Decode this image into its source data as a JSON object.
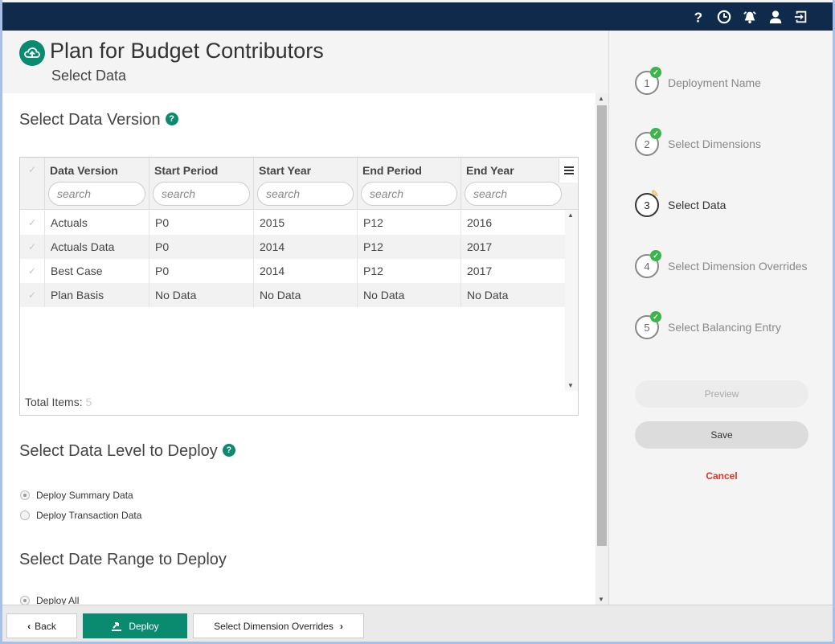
{
  "topbar": {
    "icons": [
      "help-icon",
      "history-icon",
      "alarm-icon",
      "user-icon",
      "logout-icon"
    ]
  },
  "header": {
    "title": "Plan for Budget Contributors",
    "subtitle": "Select Data"
  },
  "data_version": {
    "title": "Select Data Version",
    "help": "?",
    "columns": [
      "Data Version",
      "Start Period",
      "Start Year",
      "End Period",
      "End Year"
    ],
    "search_placeholder": "search",
    "rows": [
      [
        "Actuals",
        "P0",
        "2015",
        "P12",
        "2016"
      ],
      [
        "Actuals Data",
        "P0",
        "2014",
        "P12",
        "2017"
      ],
      [
        "Best Case",
        "P0",
        "2014",
        "P12",
        "2017"
      ],
      [
        "Plan Basis",
        "No Data",
        "No Data",
        "No Data",
        "No Data"
      ]
    ],
    "total_label": "Total Items:",
    "total_value": "5"
  },
  "data_level": {
    "title": "Select Data Level to Deploy",
    "help": "?",
    "options": [
      "Deploy Summary Data",
      "Deploy Transaction Data"
    ],
    "selected": "Deploy Summary Data"
  },
  "date_range": {
    "title": "Select Date Range to Deploy",
    "options": [
      "Deploy All"
    ],
    "selected": "Deploy All"
  },
  "steps": [
    {
      "number": "1",
      "label": "Deployment Name",
      "state": "complete"
    },
    {
      "number": "2",
      "label": "Select Dimensions",
      "state": "complete"
    },
    {
      "number": "3",
      "label": "Select Data",
      "state": "current"
    },
    {
      "number": "4",
      "label": "Select Dimension Overrides",
      "state": "complete"
    },
    {
      "number": "5",
      "label": "Select Balancing Entry",
      "state": "complete"
    }
  ],
  "actions": {
    "preview": "Preview",
    "save": "Save",
    "cancel": "Cancel"
  },
  "footer": {
    "back": "Back",
    "deploy": "Deploy",
    "next": "Select Dimension Overrides"
  },
  "colors": {
    "brand": "#0a8a6e",
    "topbar": "#0f2a4a",
    "complete": "#3cb44b",
    "cancel": "#d13a2a"
  }
}
